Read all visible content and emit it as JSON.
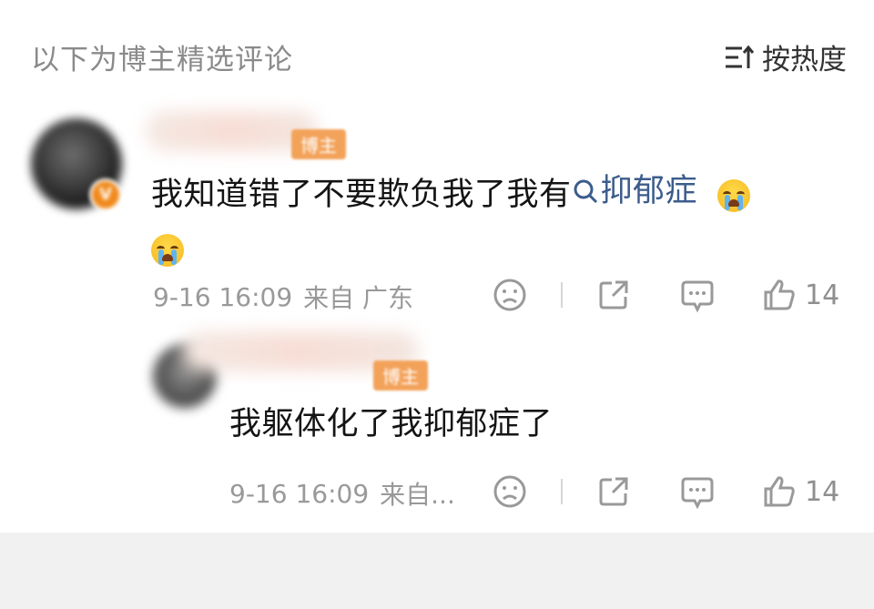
{
  "header": {
    "section_title": "以下为博主精选评论",
    "sort_label": "按热度",
    "sort_icon": "sort-lines-icon"
  },
  "comments": [
    {
      "author_tag": "博主",
      "text_before": "我知道错了不要欺负我了我有",
      "topic_link": "抑郁症",
      "emoji_count": 2,
      "emoji_icon": "crying-face-emoji",
      "time": "9-16 16:09",
      "location": "来自 广东",
      "like_count": "14"
    }
  ],
  "reply": {
    "author_tag": "博主",
    "text": "我躯体化了我抑郁症了",
    "time": "9-16 16:09",
    "location": "来自...",
    "like_count": "14"
  },
  "colors": {
    "link": "#3c5c8c",
    "tag_bg": "#f3a25a",
    "meta": "#999999"
  }
}
